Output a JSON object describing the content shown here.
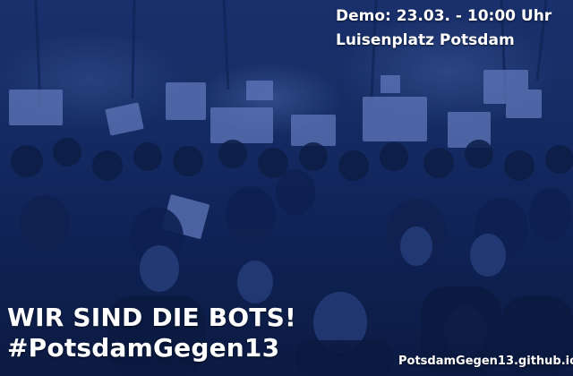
{
  "poster": {
    "event_date": "Demo: 23.03. - 10:00 Uhr",
    "event_place": "Luisenplatz Potsdam",
    "headline": "WIR SIND DIE BOTS!",
    "hashtag": "#PotsdamGegen13",
    "website": "PotsdamGegen13.github.io"
  },
  "colors": {
    "tint": "#1a3a8a",
    "text": "#ffffff"
  }
}
